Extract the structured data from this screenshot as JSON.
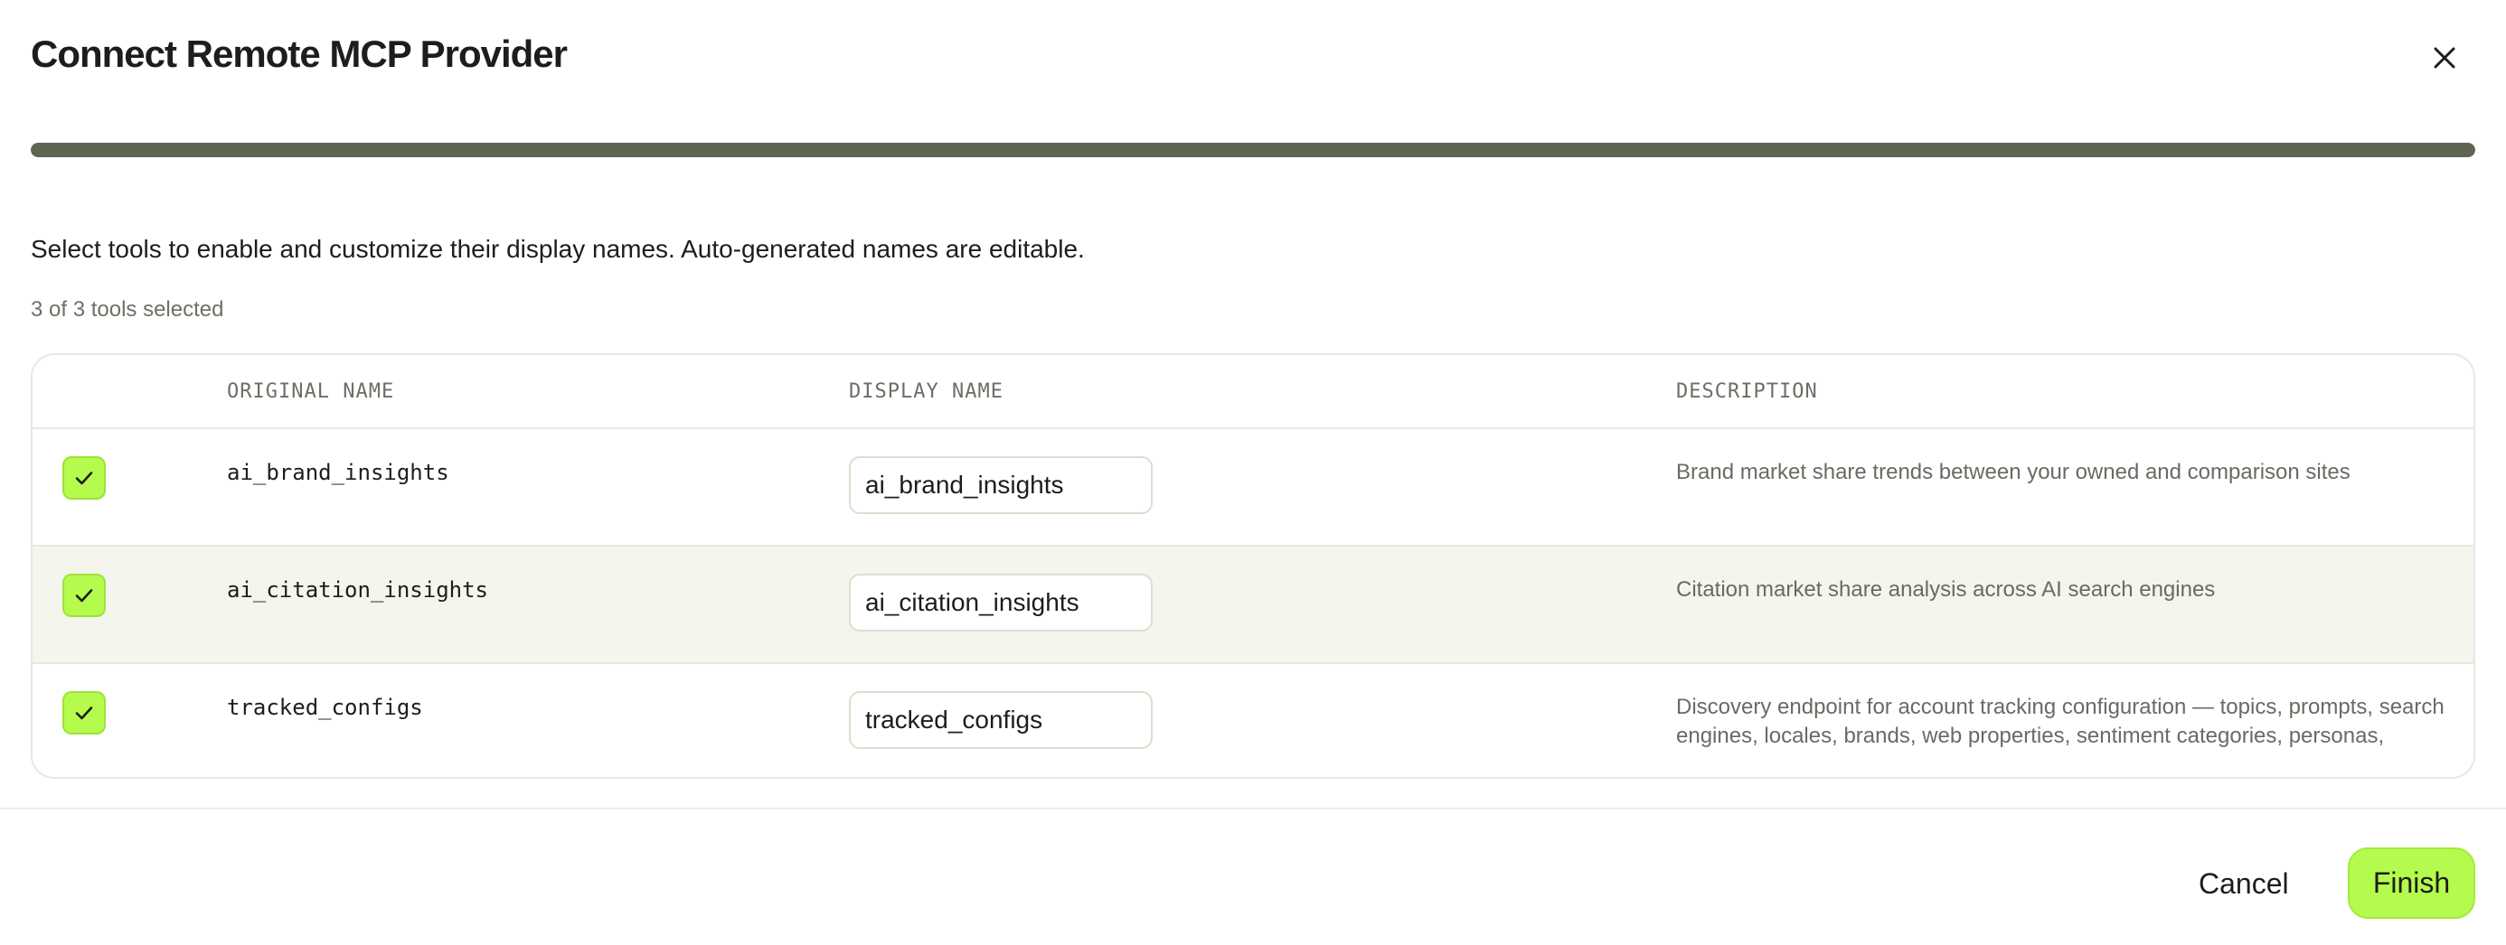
{
  "dialog": {
    "title": "Connect Remote MCP Provider",
    "close_icon": "close-icon",
    "progress": {
      "percent": 100,
      "color": "#5f6553"
    }
  },
  "instructions": "Select tools to enable and customize their display names. Auto-generated names are editable.",
  "selection": {
    "summary": "3 of 3 tools selected"
  },
  "table": {
    "headers": {
      "original_name": "ORIGINAL NAME",
      "display_name": "DISPLAY NAME",
      "description": "DESCRIPTION"
    },
    "rows": [
      {
        "checked": true,
        "checkbox_icon": "check-icon",
        "original_name": "ai_brand_insights",
        "display_name": "ai_brand_insights",
        "description": "Brand market share trends between your owned and comparison sites"
      },
      {
        "checked": true,
        "checkbox_icon": "check-icon",
        "original_name": "ai_citation_insights",
        "display_name": "ai_citation_insights",
        "description": "Citation market share analysis across AI search engines"
      },
      {
        "checked": true,
        "checkbox_icon": "check-icon",
        "original_name": "tracked_configs",
        "display_name": "tracked_configs",
        "description": "Discovery endpoint for account tracking configuration — topics, prompts, search engines, locales, brands, web properties, sentiment categories, personas, intents,..."
      }
    ]
  },
  "footer": {
    "cancel_label": "Cancel",
    "finish_label": "Finish"
  },
  "colors": {
    "accent": "#b4fb4d",
    "progress": "#5f6553",
    "border": "#e6e9dc",
    "row_alt": "#f4f6ee"
  }
}
